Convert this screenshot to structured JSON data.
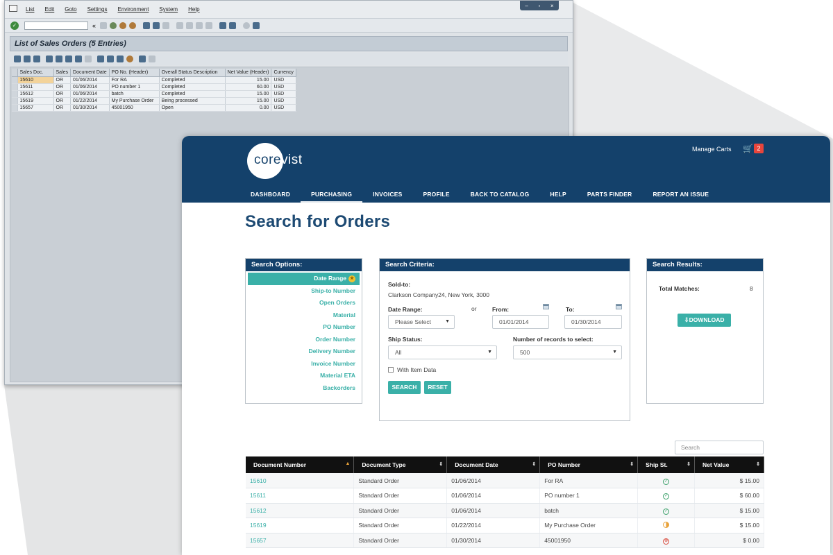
{
  "sap": {
    "menu": [
      "List",
      "Edit",
      "Goto",
      "Settings",
      "Environment",
      "System",
      "Help"
    ],
    "window_controls": [
      "–",
      "▫",
      "×"
    ],
    "command_field": "",
    "back_label": "«",
    "title": "List of Sales Orders (5 Entries)",
    "columns": [
      "Sales Doc.",
      "Sales",
      "Document Date",
      "PO No. (Header)",
      "Overall Status Description",
      "Net Value (Header)",
      "Currency"
    ],
    "rows": [
      [
        "15610",
        "OR",
        "01/06/2014",
        "For RA",
        "Completed",
        "15.00",
        "USD"
      ],
      [
        "15611",
        "OR",
        "01/06/2014",
        "PO number 1",
        "Completed",
        "60.00",
        "USD"
      ],
      [
        "15612",
        "OR",
        "01/06/2014",
        "batch",
        "Completed",
        "15.00",
        "USD"
      ],
      [
        "15619",
        "OR",
        "01/22/2014",
        "My Purchase Order",
        "Being processed",
        "15.00",
        "USD"
      ],
      [
        "15657",
        "OR",
        "01/30/2014",
        "45001950",
        "Open",
        "0.00",
        "USD"
      ]
    ]
  },
  "corevist": {
    "logo": {
      "part1": "core",
      "part2": "vist"
    },
    "manage_carts": "Manage Carts",
    "cart_count": "2",
    "nav": [
      "DASHBOARD",
      "PURCHASING",
      "INVOICES",
      "PROFILE",
      "BACK TO CATALOG",
      "HELP",
      "PARTS FINDER",
      "REPORT AN ISSUE"
    ],
    "active_nav": "PURCHASING",
    "page_title": "Search for Orders",
    "options": {
      "title": "Search Options:",
      "items": [
        "Date Range",
        "Ship-to Number",
        "Open Orders",
        "Material",
        "PO Number",
        "Order Number",
        "Delivery Number",
        "Invoice Number",
        "Material ETA",
        "Backorders"
      ]
    },
    "criteria": {
      "title": "Search Criteria:",
      "sold_to_label": "Sold-to:",
      "sold_to_value": "Clarkson Company24, New York, 3000",
      "date_range_label": "Date Range:",
      "date_range_value": "Please Select",
      "or_label": "or",
      "from_label": "From:",
      "from_value": "01/01/2014",
      "to_label": "To:",
      "to_value": "01/30/2014",
      "ship_status_label": "Ship Status:",
      "ship_status_value": "All",
      "records_label": "Number of records to select:",
      "records_value": "500",
      "item_data_label": "With Item Data",
      "search_button": "SEARCH",
      "reset_button": "RESET"
    },
    "results": {
      "title": "Search Results:",
      "total_label": "Total Matches:",
      "total_value": "8",
      "download_button": "DOWNLOAD"
    },
    "search_placeholder": "Search",
    "table": {
      "columns": [
        "Document Number",
        "Document Type",
        "Document Date",
        "PO Number",
        "Ship St.",
        "Net Value"
      ],
      "rows": [
        {
          "doc": "15610",
          "type": "Standard Order",
          "date": "01/06/2014",
          "po": "For RA",
          "status": "complete",
          "value": "$ 15.00"
        },
        {
          "doc": "15611",
          "type": "Standard Order",
          "date": "01/06/2014",
          "po": "PO number 1",
          "status": "complete",
          "value": "$ 60.00"
        },
        {
          "doc": "15612",
          "type": "Standard Order",
          "date": "01/06/2014",
          "po": "batch",
          "status": "complete",
          "value": "$ 15.00"
        },
        {
          "doc": "15619",
          "type": "Standard Order",
          "date": "01/22/2014",
          "po": "My Purchase Order",
          "status": "partial",
          "value": "$ 15.00"
        },
        {
          "doc": "15657",
          "type": "Standard Order",
          "date": "01/30/2014",
          "po": "45001950",
          "status": "open",
          "value": "$ 0.00"
        }
      ]
    },
    "colors": {
      "navy": "#14416b",
      "teal": "#3ab0a8",
      "badge": "#e8453c"
    }
  }
}
